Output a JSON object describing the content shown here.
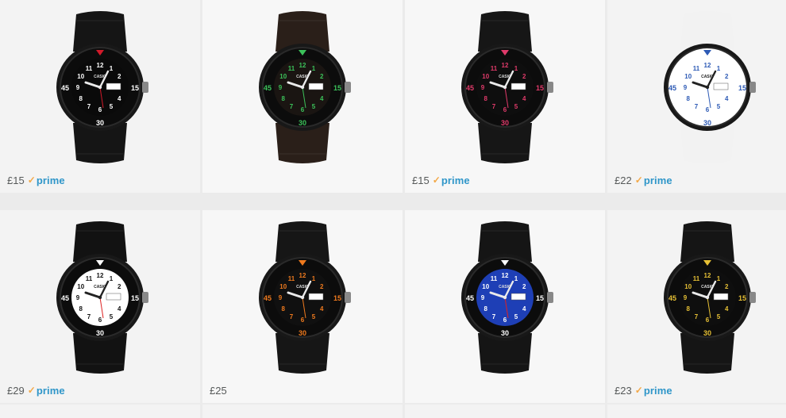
{
  "products": [
    {
      "price": "£15",
      "prime": true,
      "dial": "#0a0a0a",
      "strap": "#151515",
      "accent": "#ffffff",
      "marker": "#d21a2a",
      "image_desc": "watch-black-white-dial"
    },
    {
      "price": "",
      "prime": false,
      "dial": "#1a1512",
      "strap": "#2a1f19",
      "accent": "#3cc25a",
      "marker": "#3cc25a",
      "image_desc": "watch-brown-green-dial"
    },
    {
      "price": "£15",
      "prime": true,
      "dial": "#0e0e0e",
      "strap": "#161616",
      "accent": "#e03a6a",
      "marker": "#e03a6a",
      "image_desc": "watch-black-pink-dial"
    },
    {
      "price": "£22",
      "prime": true,
      "dial": "#ffffff",
      "strap": "#f2f2f2",
      "accent": "#2d5ab5",
      "marker": "#2d5ab5",
      "image_desc": "watch-white-blue-dial"
    },
    {
      "price": "£29",
      "prime": true,
      "dial": "#ffffff",
      "strap": "#121212",
      "accent": "#111111",
      "marker": "#ffffff",
      "image_desc": "watch-black-white-face"
    },
    {
      "price": "£25",
      "prime": false,
      "dial": "#101010",
      "strap": "#161616",
      "accent": "#ef7a1e",
      "marker": "#ef7a1e",
      "image_desc": "watch-black-orange-dial"
    },
    {
      "price": "",
      "prime": false,
      "dial": "#1e3fb6",
      "strap": "#151515",
      "accent": "#ffffff",
      "marker": "#ffffff",
      "image_desc": "watch-black-blue-dial"
    },
    {
      "price": "£23",
      "prime": true,
      "dial": "#0e0e0e",
      "strap": "#151515",
      "accent": "#e6c035",
      "marker": "#e6c035",
      "image_desc": "watch-black-yellow-dial"
    }
  ],
  "prime_label": "prime",
  "prime_check": "✓",
  "watch_brand": "CASIO",
  "bezel_numbers": [
    "15",
    "30",
    "45"
  ]
}
